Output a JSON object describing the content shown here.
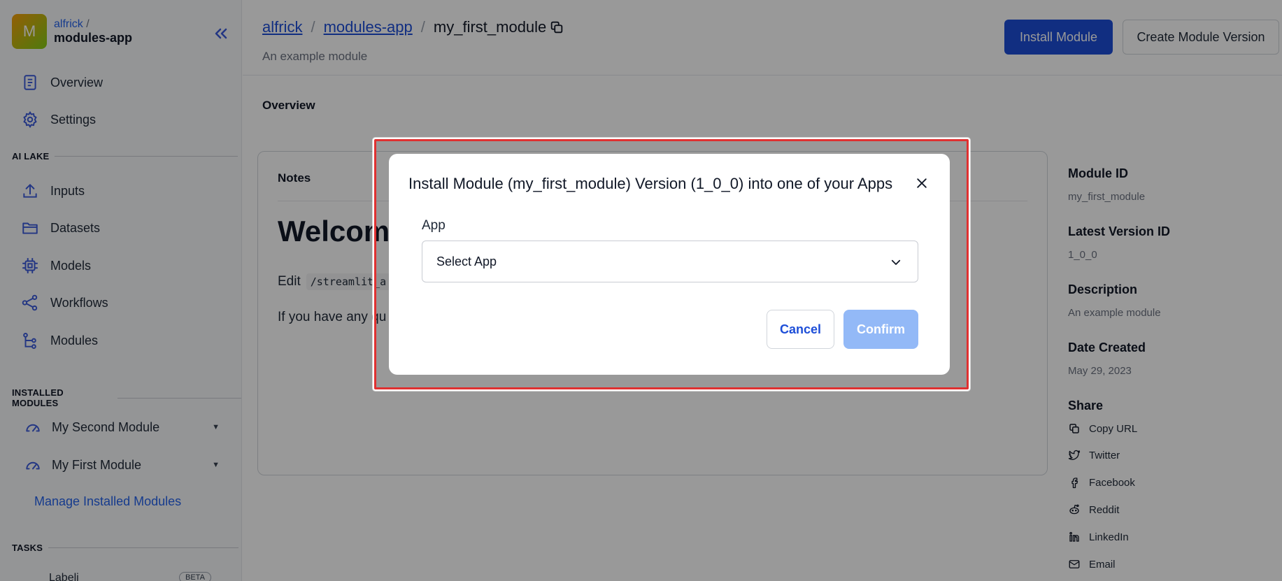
{
  "workspace": {
    "avatar_letter": "M",
    "owner": "alfrick",
    "slash": "/",
    "app": "modules-app"
  },
  "sidebar": {
    "top_items": [
      {
        "label": "Overview",
        "icon": "document-icon"
      },
      {
        "label": "Settings",
        "icon": "gear-icon"
      }
    ],
    "ai_lake": {
      "title": "AI LAKE",
      "items": [
        {
          "label": "Inputs",
          "icon": "upload-icon"
        },
        {
          "label": "Datasets",
          "icon": "folder-icon"
        },
        {
          "label": "Models",
          "icon": "chip-icon"
        },
        {
          "label": "Workflows",
          "icon": "share-nodes-icon"
        },
        {
          "label": "Modules",
          "icon": "branch-icon"
        }
      ]
    },
    "installed_modules": {
      "title": "INSTALLED MODULES",
      "items": [
        {
          "label": "My Second Module"
        },
        {
          "label": "My First Module"
        }
      ],
      "manage_label": "Manage Installed Modules"
    },
    "tasks": {
      "title": "TASKS",
      "partial_item": "Labeli",
      "badge": "BETA"
    }
  },
  "header": {
    "breadcrumbs": [
      "alfrick",
      "modules-app"
    ],
    "separator": "/",
    "title": "my_first_module",
    "subtitle": "An example module",
    "install_label": "Install Module",
    "create_version_label": "Create Module Version"
  },
  "tabs": {
    "active": "Overview"
  },
  "notes": {
    "label": "Notes",
    "heading": "Welcome",
    "edit_prefix": "Edit",
    "edit_code": "/streamlit_a",
    "questions": "If you have any qu"
  },
  "meta": {
    "module_id_label": "Module ID",
    "module_id": "my_first_module",
    "latest_version_label": "Latest Version ID",
    "latest_version": "1_0_0",
    "description_label": "Description",
    "description": "An example module",
    "date_created_label": "Date Created",
    "date_created": "May 29, 2023",
    "share_label": "Share",
    "share_items": [
      {
        "label": "Copy URL",
        "icon": "copy-icon"
      },
      {
        "label": "Twitter",
        "icon": "twitter-icon"
      },
      {
        "label": "Facebook",
        "icon": "facebook-icon"
      },
      {
        "label": "Reddit",
        "icon": "reddit-icon"
      },
      {
        "label": "LinkedIn",
        "icon": "linkedin-icon"
      },
      {
        "label": "Email",
        "icon": "email-icon"
      }
    ]
  },
  "modal": {
    "title": "Install Module (my_first_module) Version (1_0_0) into one of your Apps",
    "field_label": "App",
    "select_value": "Select App",
    "cancel_label": "Cancel",
    "confirm_label": "Confirm"
  },
  "colors": {
    "primary": "#1d4ed8",
    "confirm_disabled": "#93b9f7",
    "highlight": "#e03131"
  }
}
